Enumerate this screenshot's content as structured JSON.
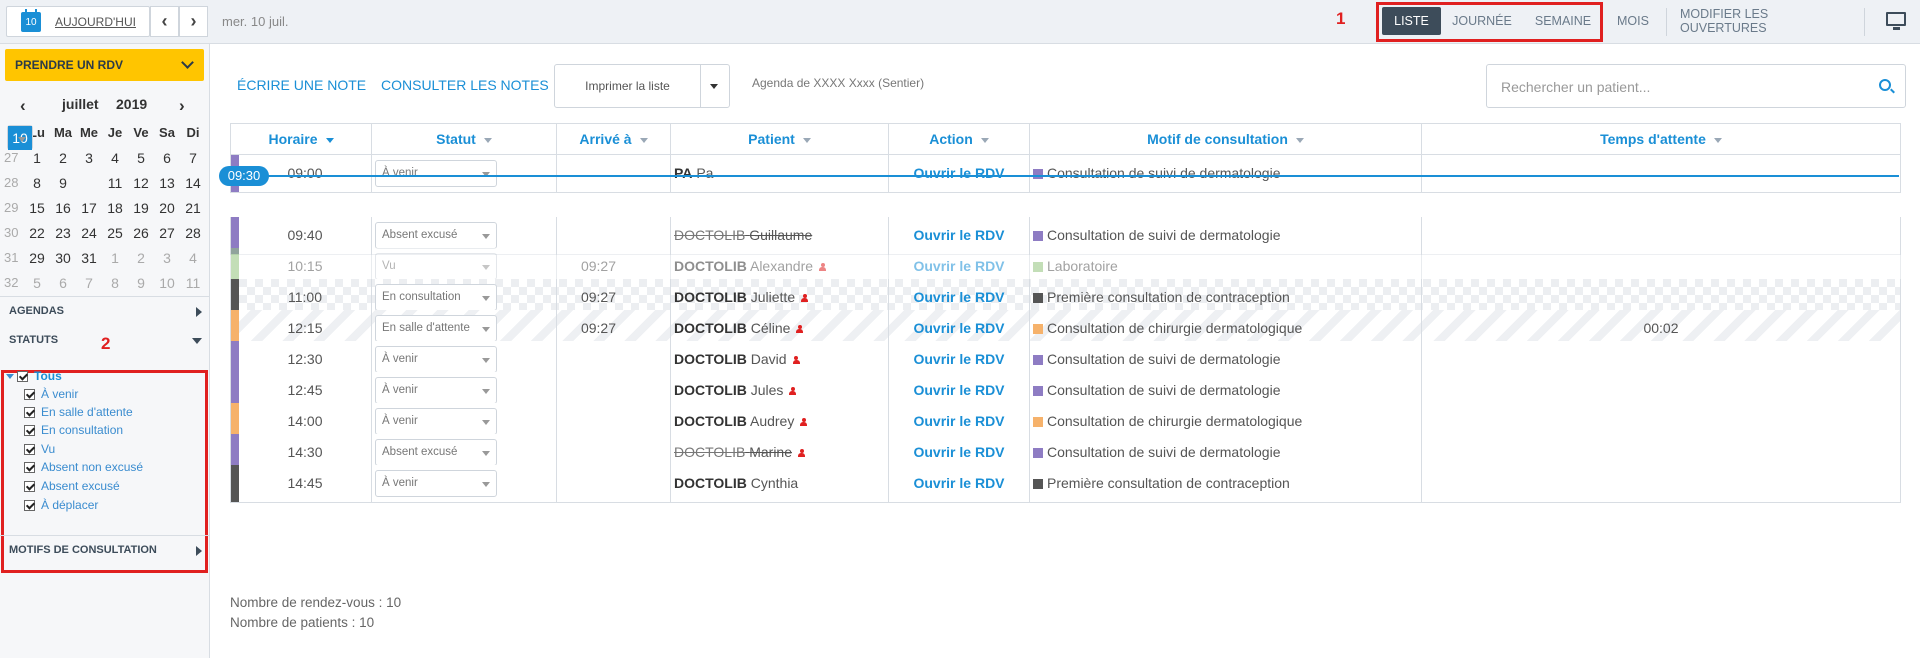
{
  "topbar": {
    "calendar_day": "10",
    "today_label": "AUJOURD'HUI",
    "prev_arrow": "‹",
    "next_arrow": "›",
    "current_date": "mer. 10 juil.",
    "annotation": "1",
    "views": [
      "LISTE",
      "JOURNÉE",
      "SEMAINE"
    ],
    "active_view": "LISTE",
    "mois_label": "MOIS",
    "modify_label": "MODIFIER LES OUVERTURES"
  },
  "sidebar": {
    "rdv_button": "PRENDRE UN RDV",
    "calendar": {
      "month": "juillet",
      "year": "2019",
      "day_headers": [
        "Lu",
        "Ma",
        "Me",
        "Je",
        "Ve",
        "Sa",
        "Di"
      ],
      "weeks": [
        {
          "num": "27",
          "days": [
            "1",
            "2",
            "3",
            "4",
            "5",
            "6",
            "7"
          ]
        },
        {
          "num": "28",
          "days": [
            "8",
            "9",
            "10",
            "11",
            "12",
            "13",
            "14"
          ]
        },
        {
          "num": "29",
          "days": [
            "15",
            "16",
            "17",
            "18",
            "19",
            "20",
            "21"
          ]
        },
        {
          "num": "30",
          "days": [
            "22",
            "23",
            "24",
            "25",
            "26",
            "27",
            "28"
          ]
        },
        {
          "num": "31",
          "days": [
            "29",
            "30",
            "31",
            "1",
            "2",
            "3",
            "4"
          ]
        },
        {
          "num": "32",
          "days": [
            "5",
            "6",
            "7",
            "8",
            "9",
            "10",
            "11"
          ]
        }
      ],
      "selected_day": "10"
    },
    "agendas_label": "AGENDAS",
    "statuts_label": "STATUTS",
    "annotation": "2",
    "statuses": {
      "tous": "Tous",
      "items": [
        "À venir",
        "En salle d'attente",
        "En consultation",
        "Vu",
        "Absent non excusé",
        "Absent excusé",
        "À déplacer"
      ]
    },
    "motifs_label": "MOTIFS DE CONSULTATION"
  },
  "toolbar": {
    "write_note": "ÉCRIRE UNE NOTE",
    "view_notes": "CONSULTER LES NOTES",
    "print_label": "Imprimer la liste",
    "agenda_label": "Agenda de XXXX Xxxx (Sentier)",
    "search_placeholder": "Rechercher un patient..."
  },
  "table": {
    "headers": [
      "Horaire",
      "Statut",
      "Arrivé à",
      "Patient",
      "Action",
      "Motif de consultation",
      "Temps d'attente"
    ],
    "now_label": "09:30",
    "rows": [
      {
        "time": "09:00",
        "status": "À venir",
        "arrived": "",
        "last": "PA",
        "first": "Pa",
        "action": "Ouvrir le RDV",
        "motif": "Consultation de suivi de dermatologie",
        "wait": "",
        "bar": "#8e7cc3",
        "motif_color": "#8e7cc3"
      },
      {
        "time": "09:40",
        "status": "Absent excusé",
        "arrived": "",
        "last": "DOCTOLIB",
        "first": "Guillaume",
        "action": "Ouvrir le RDV",
        "motif": "Consultation de suivi de dermatologie",
        "wait": "",
        "bar": "#8e7cc3",
        "motif_color": "#8e7cc3"
      },
      {
        "time": "10:15",
        "status": "Vu",
        "arrived": "09:27",
        "last": "DOCTOLIB",
        "first": "Alexandre",
        "action": "Ouvrir le RDV",
        "motif": "Laboratoire",
        "wait": "",
        "bar": "#93c47d",
        "motif_color": "#93c47d"
      },
      {
        "time": "11:00",
        "status": "En consultation",
        "arrived": "09:27",
        "last": "DOCTOLIB",
        "first": "Juliette",
        "action": "Ouvrir le RDV",
        "motif": "Première consultation de contraception",
        "wait": "",
        "bar": "#555555",
        "motif_color": "#555555"
      },
      {
        "time": "12:15",
        "status": "En salle d'attente",
        "arrived": "09:27",
        "last": "DOCTOLIB",
        "first": "Céline",
        "action": "Ouvrir le RDV",
        "motif": "Consultation de chirurgie dermatologique",
        "wait": "00:02",
        "bar": "#f6b26b",
        "motif_color": "#f6b26b"
      },
      {
        "time": "12:30",
        "status": "À venir",
        "arrived": "",
        "last": "DOCTOLIB",
        "first": "David",
        "action": "Ouvrir le RDV",
        "motif": "Consultation de suivi de dermatologie",
        "wait": "",
        "bar": "#8e7cc3",
        "motif_color": "#8e7cc3"
      },
      {
        "time": "12:45",
        "status": "À venir",
        "arrived": "",
        "last": "DOCTOLIB",
        "first": "Jules",
        "action": "Ouvrir le RDV",
        "motif": "Consultation de suivi de dermatologie",
        "wait": "",
        "bar": "#8e7cc3",
        "motif_color": "#8e7cc3"
      },
      {
        "time": "14:00",
        "status": "À venir",
        "arrived": "",
        "last": "DOCTOLIB",
        "first": "Audrey",
        "action": "Ouvrir le RDV",
        "motif": "Consultation de chirurgie dermatologique",
        "wait": "",
        "bar": "#f6b26b",
        "motif_color": "#f6b26b"
      },
      {
        "time": "14:30",
        "status": "Absent excusé",
        "arrived": "",
        "last": "DOCTOLIB",
        "first": "Marine",
        "action": "Ouvrir le RDV",
        "motif": "Consultation de suivi de dermatologie",
        "wait": "",
        "bar": "#8e7cc3",
        "motif_color": "#8e7cc3"
      },
      {
        "time": "14:45",
        "status": "À venir",
        "arrived": "",
        "last": "DOCTOLIB",
        "first": "Cynthia",
        "action": "Ouvrir le RDV",
        "motif": "Première consultation de contraception",
        "wait": "",
        "bar": "#555555",
        "motif_color": "#555555"
      }
    ]
  },
  "footer": {
    "appointments": "Nombre de rendez-vous : 10",
    "patients": "Nombre de patients : 10"
  },
  "colors": {
    "accent": "#1a8fd6",
    "brand_yellow": "#ffc500",
    "annotation_red": "#e02020",
    "active_tab": "#3d4c5a"
  }
}
